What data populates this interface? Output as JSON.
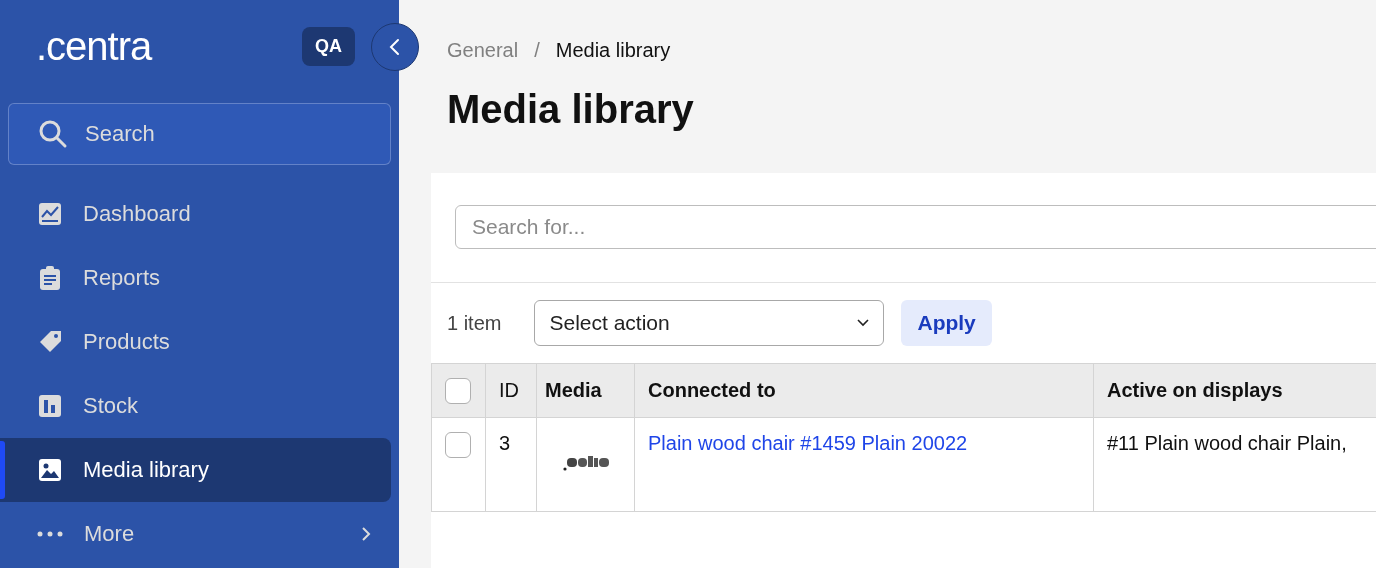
{
  "sidebar": {
    "logo": ".centra",
    "env_badge": "QA",
    "search": {
      "placeholder": "Search"
    },
    "items": [
      {
        "label": "Dashboard",
        "selected": false
      },
      {
        "label": "Reports",
        "selected": false
      },
      {
        "label": "Products",
        "selected": false
      },
      {
        "label": "Stock",
        "selected": false
      },
      {
        "label": "Media library",
        "selected": true
      },
      {
        "label": "More",
        "selected": false
      }
    ]
  },
  "breadcrumb": {
    "separator": "/",
    "items": [
      "General",
      "Media library"
    ]
  },
  "page_title": "Media library",
  "search": {
    "placeholder": "Search for..."
  },
  "toolbar": {
    "count": "1 item",
    "action_select": "Select action",
    "apply": "Apply"
  },
  "table": {
    "select_all_checked": false,
    "columns": [
      "ID",
      "Media",
      "Connected to",
      "Active on displays"
    ],
    "rows": [
      {
        "checked": false,
        "id": "3",
        "connected_to": "Plain wood chair #1459 Plain 20022",
        "active_on_displays": "#11 Plain wood chair Plain,"
      }
    ]
  }
}
